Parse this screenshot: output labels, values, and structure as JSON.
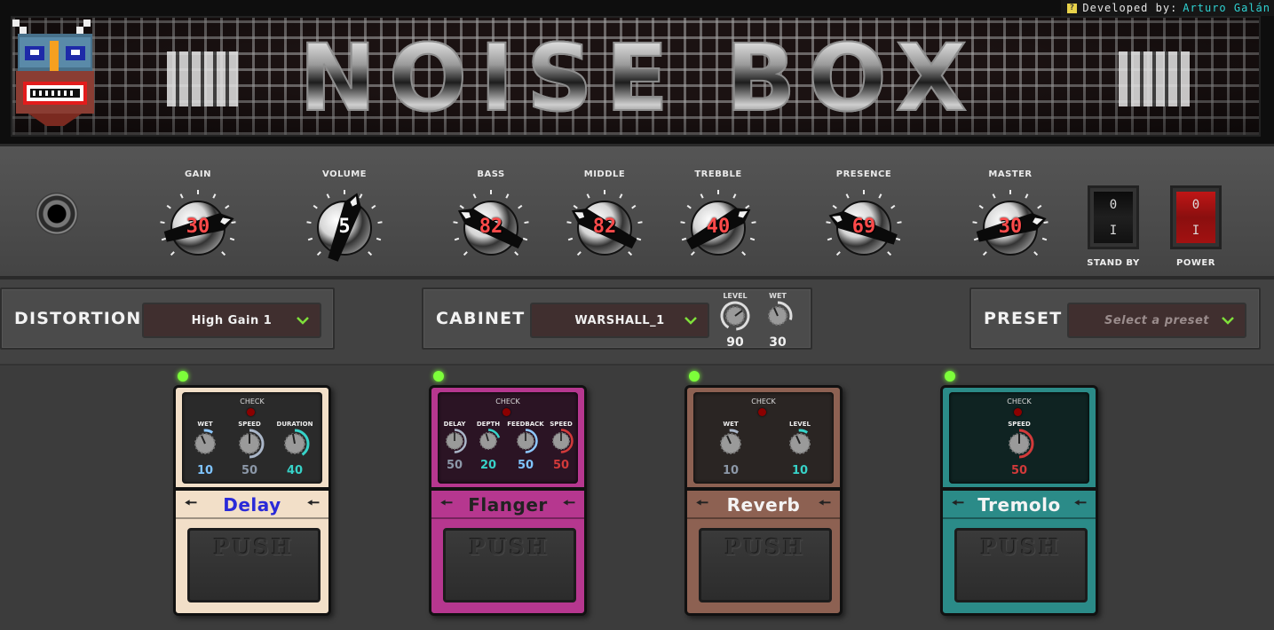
{
  "credit": {
    "prefix": "Developed by:",
    "author": "Arturo Galán"
  },
  "header": {
    "title": "NOISE BOX"
  },
  "amp": {
    "knobs": [
      {
        "label": "GAIN",
        "value": "30",
        "angle": 75
      },
      {
        "label": "VOLUME",
        "value": "5",
        "angle": 20
      },
      {
        "label": "BASS",
        "value": "82",
        "angle": -62
      },
      {
        "label": "MIDDLE",
        "value": "82",
        "angle": -62
      },
      {
        "label": "TREBBLE",
        "value": "40",
        "angle": 60
      },
      {
        "label": "PRESENCE",
        "value": "69",
        "angle": -70
      },
      {
        "label": "MASTER",
        "value": "30",
        "angle": 75
      }
    ],
    "standby": {
      "label": "STAND BY",
      "top": "0",
      "bottom": "I"
    },
    "power": {
      "label": "POWER",
      "top": "0",
      "bottom": "I"
    }
  },
  "distortion": {
    "title": "DISTORTION",
    "selected": "High Gain 1"
  },
  "cabinet": {
    "title": "CABINET",
    "selected": "WARSHALL_1",
    "level": {
      "label": "LEVEL",
      "value": "90"
    },
    "wet": {
      "label": "WET",
      "value": "30"
    }
  },
  "preset": {
    "title": "PRESET",
    "placeholder": "Select a preset"
  },
  "pedals": {
    "push_label": "PUSH",
    "check_label": "CHECK",
    "delay": {
      "name": "Delay",
      "knobs": [
        {
          "label": "WET",
          "value": "10"
        },
        {
          "label": "SPEED",
          "value": "50"
        },
        {
          "label": "DURATION",
          "value": "40"
        }
      ]
    },
    "flanger": {
      "name": "Flanger",
      "knobs": [
        {
          "label": "DELAY",
          "value": "50"
        },
        {
          "label": "DEPTH",
          "value": "20"
        },
        {
          "label": "FEEDBACK",
          "value": "50"
        },
        {
          "label": "SPEED",
          "value": "50"
        }
      ]
    },
    "reverb": {
      "name": "Reverb",
      "knobs": [
        {
          "label": "WET",
          "value": "10"
        },
        {
          "label": "LEVEL",
          "value": "10"
        }
      ]
    },
    "tremolo": {
      "name": "Tremolo",
      "knobs": [
        {
          "label": "SPEED",
          "value": "50"
        }
      ]
    }
  },
  "colors": {
    "led": "#7dff3a",
    "knob_value": "#ff4a4a",
    "delay_name": "#2a2ad8",
    "delay_body": "#f2dfc8",
    "flanger_body": "#b6378f",
    "reverb_body": "#8d6152",
    "tremolo_body": "#2b8b88"
  }
}
